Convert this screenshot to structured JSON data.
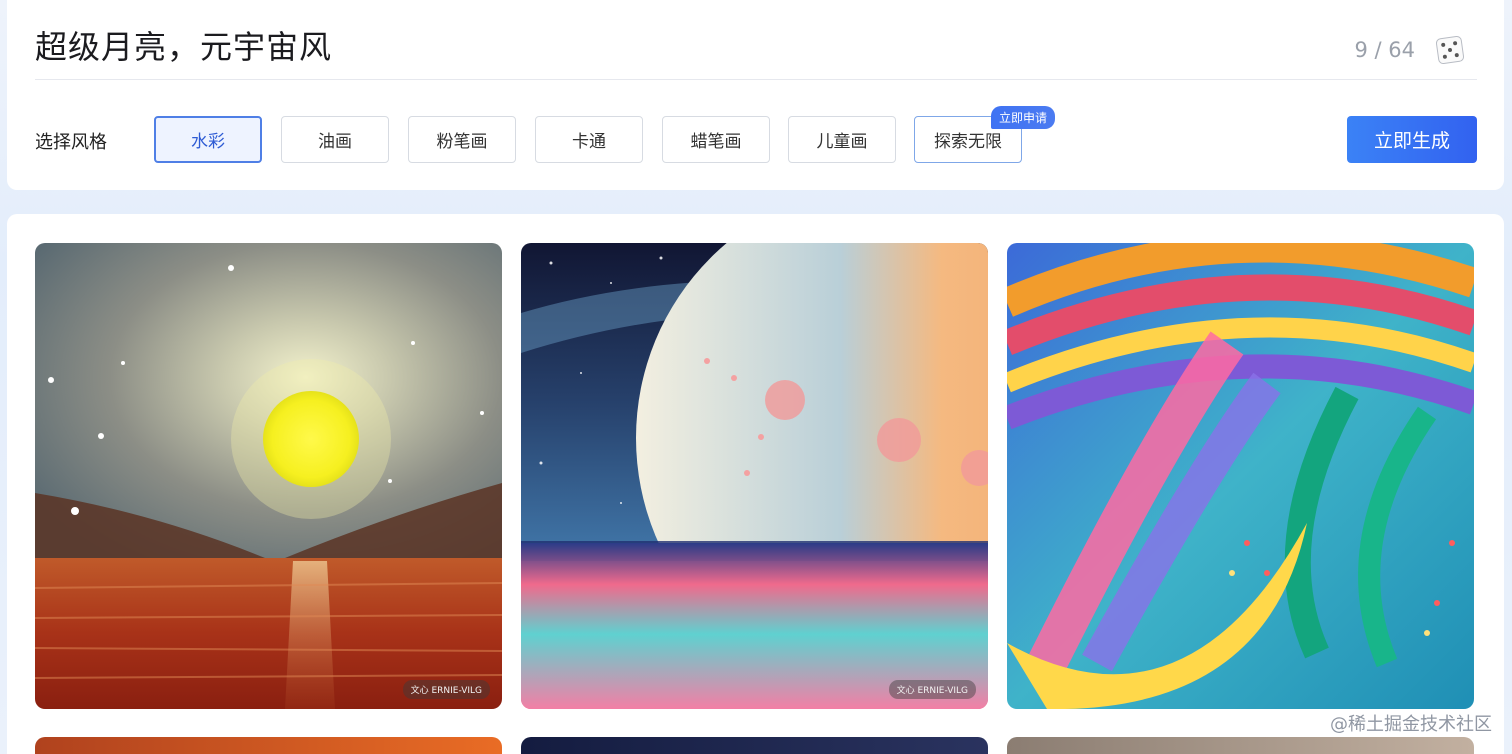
{
  "header": {
    "prompt": "超级月亮，元宇宙风",
    "counter": "9 / 64",
    "dice_icon": "dice-icon"
  },
  "styles": {
    "label": "选择风格",
    "options": [
      "水彩",
      "油画",
      "粉笔画",
      "卡通",
      "蜡笔画",
      "儿童画",
      "探索无限"
    ],
    "selected": "水彩",
    "badge": "立即申请"
  },
  "actions": {
    "generate_label": "立即生成"
  },
  "gallery": {
    "watermark": "文心 ERNIE-VILG",
    "images": [
      {
        "subject": "yellow-moon-over-red-sea"
      },
      {
        "subject": "large-moon-over-pastel-sea"
      },
      {
        "subject": "crescent-moon-rainbow-swirls"
      }
    ]
  },
  "footer": {
    "site_watermark": "@稀土掘金技术社区"
  },
  "colors": {
    "primary": "#3b6ef2",
    "selected_bg": "#eef3ff"
  }
}
